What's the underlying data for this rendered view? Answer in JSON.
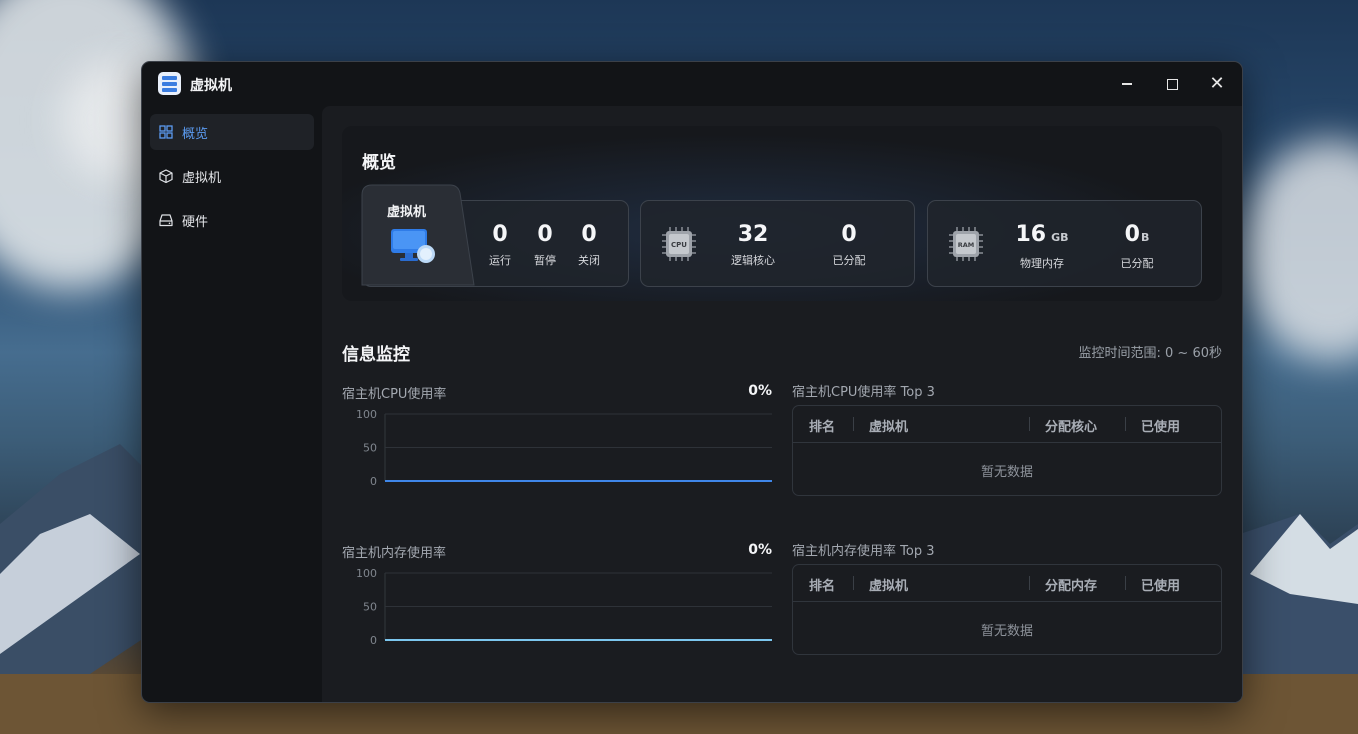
{
  "window": {
    "title": "虚拟机",
    "controls": [
      "minimize-icon",
      "maximize-icon",
      "close-icon"
    ]
  },
  "sidebar": {
    "items": [
      {
        "label": "概览",
        "icon": "grid-icon",
        "active": true
      },
      {
        "label": "虚拟机",
        "icon": "cube-icon",
        "active": false
      },
      {
        "label": "硬件",
        "icon": "drive-icon",
        "active": false
      }
    ]
  },
  "overview": {
    "title": "概览",
    "vm_card": {
      "label": "虚拟机",
      "stats": [
        {
          "value": "0",
          "label": "运行"
        },
        {
          "value": "0",
          "label": "暂停"
        },
        {
          "value": "0",
          "label": "关闭"
        }
      ]
    },
    "cpu_card": {
      "icon_text": "CPU",
      "stats": [
        {
          "value": "32",
          "unit": "",
          "label": "逻辑核心"
        },
        {
          "value": "0",
          "unit": "",
          "label": "已分配"
        }
      ]
    },
    "ram_card": {
      "icon_text": "RAM",
      "stats": [
        {
          "value": "16",
          "unit": "GB",
          "label": "物理内存"
        },
        {
          "value": "0",
          "unit": "B",
          "label": "已分配"
        }
      ]
    }
  },
  "monitor": {
    "title": "信息监控",
    "range_label": "监控时间范围: 0 ~ 60秒",
    "cpu_chart": {
      "title": "宿主机CPU使用率",
      "value": "0%"
    },
    "mem_chart": {
      "title": "宿主机内存使用率",
      "value": "0%"
    },
    "cpu_table": {
      "title": "宿主机CPU使用率 Top 3",
      "columns": [
        "排名",
        "虚拟机",
        "分配核心",
        "已使用"
      ],
      "empty_text": "暂无数据"
    },
    "mem_table": {
      "title": "宿主机内存使用率 Top 3",
      "columns": [
        "排名",
        "虚拟机",
        "分配内存",
        "已使用"
      ],
      "empty_text": "暂无数据"
    }
  },
  "colors": {
    "accent": "#3b7de0",
    "cpu_line": "#3f86e8",
    "mem_line": "#7cc6ee"
  },
  "chart_data": [
    {
      "type": "line",
      "title": "宿主机CPU使用率",
      "yticks": [
        "100",
        "50",
        "0"
      ],
      "ylim": [
        0,
        100
      ],
      "series": [
        {
          "values": [
            0,
            0
          ]
        }
      ],
      "grid": true
    },
    {
      "type": "line",
      "title": "宿主机内存使用率",
      "yticks": [
        "100",
        "50",
        "0"
      ],
      "ylim": [
        0,
        100
      ],
      "series": [
        {
          "values": [
            0,
            0
          ]
        }
      ],
      "grid": true
    }
  ]
}
